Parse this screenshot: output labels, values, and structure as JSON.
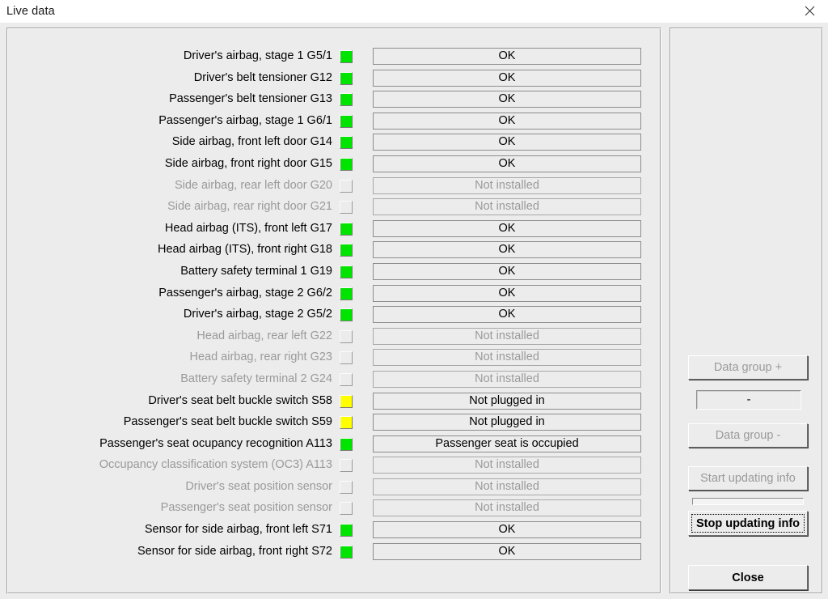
{
  "window": {
    "title": "Live data",
    "close_icon": "close-icon"
  },
  "rows": [
    {
      "label": "Driver's airbag, stage 1 G5/1",
      "led": "green",
      "value": "OK",
      "installed": true
    },
    {
      "label": "Driver's belt tensioner G12",
      "led": "green",
      "value": "OK",
      "installed": true
    },
    {
      "label": "Passenger's belt tensioner G13",
      "led": "green",
      "value": "OK",
      "installed": true
    },
    {
      "label": "Passenger's airbag, stage 1 G6/1",
      "led": "green",
      "value": "OK",
      "installed": true
    },
    {
      "label": "Side airbag, front left door G14",
      "led": "green",
      "value": "OK",
      "installed": true
    },
    {
      "label": "Side airbag, front right door G15",
      "led": "green",
      "value": "OK",
      "installed": true
    },
    {
      "label": "Side airbag, rear left door G20",
      "led": "off",
      "value": "Not installed",
      "installed": false
    },
    {
      "label": "Side airbag, rear right door G21",
      "led": "off",
      "value": "Not installed",
      "installed": false
    },
    {
      "label": "Head airbag (ITS), front left G17",
      "led": "green",
      "value": "OK",
      "installed": true
    },
    {
      "label": "Head airbag (ITS), front right G18",
      "led": "green",
      "value": "OK",
      "installed": true
    },
    {
      "label": "Battery safety terminal 1 G19",
      "led": "green",
      "value": "OK",
      "installed": true
    },
    {
      "label": "Passenger's airbag, stage 2 G6/2",
      "led": "green",
      "value": "OK",
      "installed": true
    },
    {
      "label": "Driver's airbag, stage 2 G5/2",
      "led": "green",
      "value": "OK",
      "installed": true
    },
    {
      "label": "Head airbag, rear left G22",
      "led": "off",
      "value": "Not installed",
      "installed": false
    },
    {
      "label": "Head airbag, rear right G23",
      "led": "off",
      "value": "Not installed",
      "installed": false
    },
    {
      "label": "Battery safety terminal 2 G24",
      "led": "off",
      "value": "Not installed",
      "installed": false
    },
    {
      "label": "Driver's seat belt buckle switch S58",
      "led": "yellow",
      "value": "Not plugged in",
      "installed": true
    },
    {
      "label": "Passenger's seat belt buckle switch S59",
      "led": "yellow",
      "value": "Not plugged in",
      "installed": true
    },
    {
      "label": "Passenger's seat ocupancy recognition A113",
      "led": "green",
      "value": "Passenger seat is occupied",
      "installed": true
    },
    {
      "label": "Occupancy classification system (OC3) A113",
      "led": "off",
      "value": "Not installed",
      "installed": false
    },
    {
      "label": "Driver's seat position sensor",
      "led": "off",
      "value": "Not installed",
      "installed": false
    },
    {
      "label": "Passenger's seat position sensor",
      "led": "off",
      "value": "Not installed",
      "installed": false
    },
    {
      "label": "Sensor for side airbag, front left S71",
      "led": "green",
      "value": "OK",
      "installed": true
    },
    {
      "label": "Sensor for side airbag, front right S72",
      "led": "green",
      "value": "OK",
      "installed": true
    }
  ],
  "panel": {
    "data_group_plus": "Data group +",
    "data_group_value": "-",
    "data_group_minus": "Data group -",
    "start_updating": "Start updating info",
    "stop_updating": "Stop updating info",
    "close": "Close",
    "progress_percent": 0
  },
  "colors": {
    "led_green": "#00e400",
    "led_yellow": "#ffff00",
    "led_off": "#ececec",
    "face": "#ececec",
    "text": "#000000",
    "text_disabled": "#9a9a9a"
  }
}
